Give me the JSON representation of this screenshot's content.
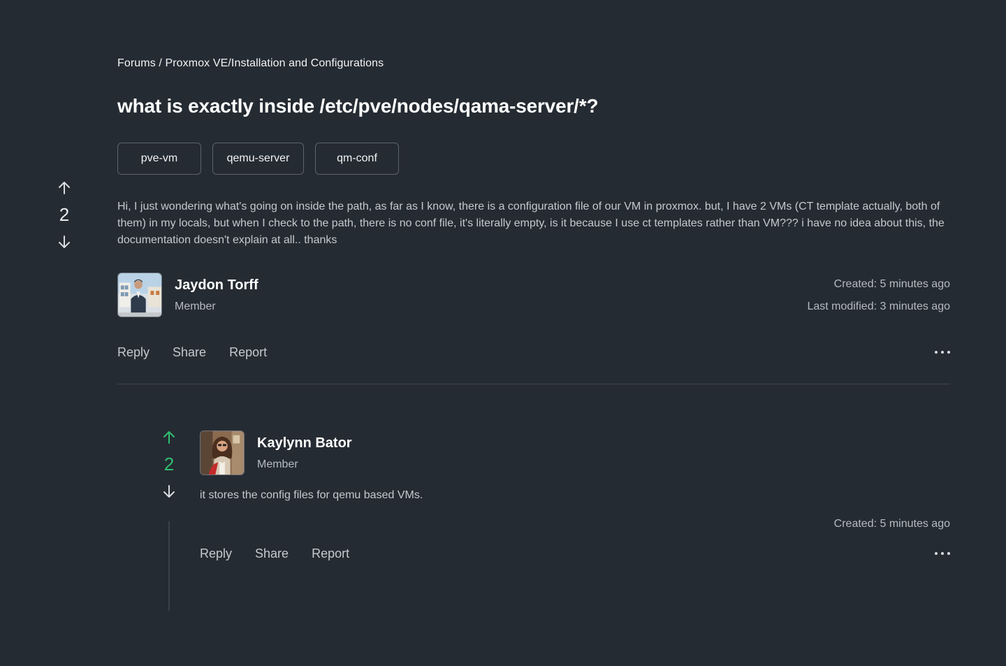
{
  "breadcrumb": "Forums / Proxmox VE/Installation and Configurations",
  "post": {
    "title": "what is exactly inside /etc/pve/nodes/qama-server/*?",
    "tags": [
      "pve-vm",
      "qemu-server",
      "qm-conf"
    ],
    "votes": "2",
    "body": "Hi, I just wondering what's going on inside the path, as far as I know, there is a configuration file of our VM in proxmox. but, I have 2 VMs (CT template actually, both of them) in my locals, but when I check to the path, there is no conf file, it's literally empty, is it because I use ct templates rather than VM??? i have no idea about this, the documentation doesn't explain at all.. thanks",
    "author": {
      "name": "Jaydon Torff",
      "role": "Member"
    },
    "created": "Created: 5 minutes ago",
    "modified": "Last modified: 3 minutes ago",
    "actions": {
      "reply": "Reply",
      "share": "Share",
      "report": "Report"
    }
  },
  "reply": {
    "votes": "2",
    "author": {
      "name": "Kaylynn Bator",
      "role": "Member"
    },
    "body": "it stores the config files for qemu based VMs.",
    "created": "Created: 5 minutes ago",
    "actions": {
      "reply": "Reply",
      "share": "Share",
      "report": "Report"
    }
  },
  "icons": {
    "upvote": "arrow-up-icon",
    "downvote": "arrow-down-icon",
    "more": "more-horizontal-icon"
  },
  "colors": {
    "background": "#252b32",
    "accent_green": "#2fbf71"
  }
}
